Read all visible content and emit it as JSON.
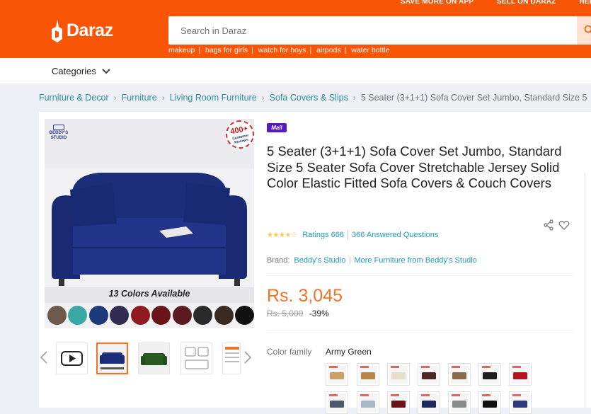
{
  "header": {
    "top_links": [
      "SAVE MORE ON APP",
      "SELL ON DARAZ",
      "HELP"
    ],
    "logo_text": "Daraz",
    "search_placeholder": "Search in Daraz",
    "suggestions": [
      "makeup",
      "bags for girls",
      "watch for boys",
      "airpods",
      "water bottle"
    ]
  },
  "nav": {
    "categories_label": "Categories"
  },
  "breadcrumb": [
    "Furniture & Decor",
    "Furniture",
    "Living Room Furniture",
    "Sofa Covers & Slips",
    "5 Seater (3+1+1) Sofa Cover Set Jumbo, Standard Size 5"
  ],
  "gallery": {
    "badge_text": "400+",
    "badge_sub": "Customer Reviews",
    "brand_logo": "BEDDY'S STUDIO",
    "caption": "13 Colors Available",
    "color_dots": [
      "#6b5a4c",
      "#3aa9a4",
      "#1d3a7a",
      "#302d52",
      "#8f1a22",
      "#6b1418",
      "#5a1a20",
      "#2a2a2a",
      "#3a2a22",
      "#111111"
    ]
  },
  "product": {
    "mall_badge": "Mall",
    "title": "5 Seater (3+1+1) Sofa Cover Set Jumbo, Standard Size 5 Seater Sofa Cover Stretchable Jersey Solid Color Elastic Fitted Sofa Covers & Couch Covers",
    "stars": "★★★★☆",
    "rating_label": "Ratings 666",
    "questions_label": "366 Answered Questions",
    "brand_label": "Brand:",
    "brand_name": "Beddy's Studio",
    "more_from": "More Furniture from Beddy's Studio",
    "price": "Rs. 3,045",
    "original_price": "Rs. 5,000",
    "discount": "-39%",
    "color_family_label": "Color family",
    "color_family_value": "Army Green",
    "swatch_colors_row1": [
      "#c9a06a",
      "#b8864a",
      "#e6dfc8",
      "#4a2a22",
      "#8a6a4a",
      "#1e1e1e",
      "#b0141c"
    ],
    "swatch_colors_row2": [
      "#4a5a6a",
      "#a9b8c8",
      "#6b1418",
      "#1d2a5a",
      "#8a8a8a",
      "#111111",
      "#2a3a7a"
    ]
  },
  "colors": {
    "brand_orange": "#f85606",
    "price_orange": "#f57224",
    "link_blue": "#1a9cb7",
    "breadcrumb_blue": "#2a8fa5",
    "mall_purple": "#561ac1",
    "sofa_navy": "#1c2d7a"
  },
  "icons": [
    "daraz-logo-icon",
    "search-icon",
    "chevron-down-icon",
    "share-icon",
    "heart-icon",
    "play-video-icon",
    "chevron-left-icon",
    "chevron-right-icon"
  ]
}
